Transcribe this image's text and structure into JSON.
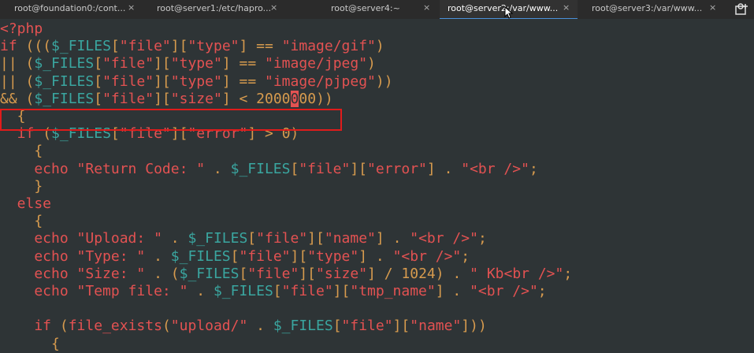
{
  "tabs": [
    {
      "label": "root@foundation0:/cont...",
      "close": "×",
      "active": false
    },
    {
      "label": "root@server1:/etc/hapro...",
      "close": "×",
      "active": false
    },
    {
      "label": "root@server4:~",
      "close": "×",
      "active": false
    },
    {
      "label": "root@server2:/var/www...",
      "close": "×",
      "active": true
    },
    {
      "label": "root@server3:/var/www...",
      "close": "×",
      "active": false
    }
  ],
  "new_tab_icon": "new-tab-icon",
  "code": {
    "l1": "<?php",
    "l2_kw": "if",
    "l2_a": " (((",
    "l2_var": "$_FILES",
    "l2_b": "[",
    "l2_s1": "\"file\"",
    "l2_c": "][",
    "l2_s2": "\"type\"",
    "l2_d": "] == ",
    "l2_s3": "\"image/gif\"",
    "l2_e": ")",
    "l3_a": "|| (",
    "l3_var": "$_FILES",
    "l3_b": "[",
    "l3_s1": "\"file\"",
    "l3_c": "][",
    "l3_s2": "\"type\"",
    "l3_d": "] == ",
    "l3_s3": "\"image/jpeg\"",
    "l3_e": ")",
    "l4_a": "|| (",
    "l4_var": "$_FILES",
    "l4_b": "[",
    "l4_s1": "\"file\"",
    "l4_c": "][",
    "l4_s2": "\"type\"",
    "l4_d": "] == ",
    "l4_s3": "\"image/pjpeg\"",
    "l4_e": "))",
    "l5_a": "&& (",
    "l5_var": "$_FILES",
    "l5_b": "[",
    "l5_s1": "\"file\"",
    "l5_c": "][",
    "l5_s2": "\"size\"",
    "l5_d": "] < ",
    "l5_n1": "2000",
    "l5_cursor": "0",
    "l5_n2": "00",
    "l5_e": "))",
    "l6": "  {",
    "l7_kw": "  if",
    "l7_a": " (",
    "l7_var": "$_FILES",
    "l7_b": "[",
    "l7_s1": "\"file\"",
    "l7_c": "][",
    "l7_s2": "\"error\"",
    "l7_d": "] > ",
    "l7_n": "0",
    "l7_e": ")",
    "l8": "    {",
    "l9_kw": "    echo",
    "l9_s1": " \"Return Code: \"",
    "l9_a": " . ",
    "l9_var": "$_FILES",
    "l9_b": "[",
    "l9_s2": "\"file\"",
    "l9_c": "][",
    "l9_s3": "\"error\"",
    "l9_d": "] . ",
    "l9_s4": "\"<br />\"",
    "l9_e": ";",
    "l10": "    }",
    "l11_kw": "  else",
    "l12": "    {",
    "l13_kw": "    echo",
    "l13_s1": " \"Upload: \"",
    "l13_a": " . ",
    "l13_var": "$_FILES",
    "l13_b": "[",
    "l13_s2": "\"file\"",
    "l13_c": "][",
    "l13_s3": "\"name\"",
    "l13_d": "] . ",
    "l13_s4": "\"<br />\"",
    "l13_e": ";",
    "l14_kw": "    echo",
    "l14_s1": " \"Type: \"",
    "l14_a": " . ",
    "l14_var": "$_FILES",
    "l14_b": "[",
    "l14_s2": "\"file\"",
    "l14_c": "][",
    "l14_s3": "\"type\"",
    "l14_d": "] . ",
    "l14_s4": "\"<br />\"",
    "l14_e": ";",
    "l15_kw": "    echo",
    "l15_s1": " \"Size: \"",
    "l15_a": " . (",
    "l15_var": "$_FILES",
    "l15_b": "[",
    "l15_s2": "\"file\"",
    "l15_c": "][",
    "l15_s3": "\"size\"",
    "l15_d": "] / ",
    "l15_n": "1024",
    "l15_e": ") . ",
    "l15_s4": "\" Kb<br />\"",
    "l15_f": ";",
    "l16_kw": "    echo",
    "l16_s1": " \"Temp file: \"",
    "l16_a": " . ",
    "l16_var": "$_FILES",
    "l16_b": "[",
    "l16_s2": "\"file\"",
    "l16_c": "][",
    "l16_s3": "\"tmp_name\"",
    "l16_d": "] . ",
    "l16_s4": "\"<br />\"",
    "l16_e": ";",
    "l17": "",
    "l18_kw": "    if",
    "l18_a": " (",
    "l18_fn": "file_exists",
    "l18_b": "(",
    "l18_s1": "\"upload/\"",
    "l18_c": " . ",
    "l18_var": "$_FILES",
    "l18_d": "[",
    "l18_s2": "\"file\"",
    "l18_e": "][",
    "l18_s3": "\"name\"",
    "l18_f": "]))",
    "l19": "      {"
  },
  "colors": {
    "background": "#2e3436",
    "keyword": "#e35252",
    "string": "#e35252",
    "variable": "#3aa6a0",
    "number": "#d79b4e",
    "highlight_border": "#e01b1b",
    "active_tab_indicator": "#4a90d9"
  }
}
